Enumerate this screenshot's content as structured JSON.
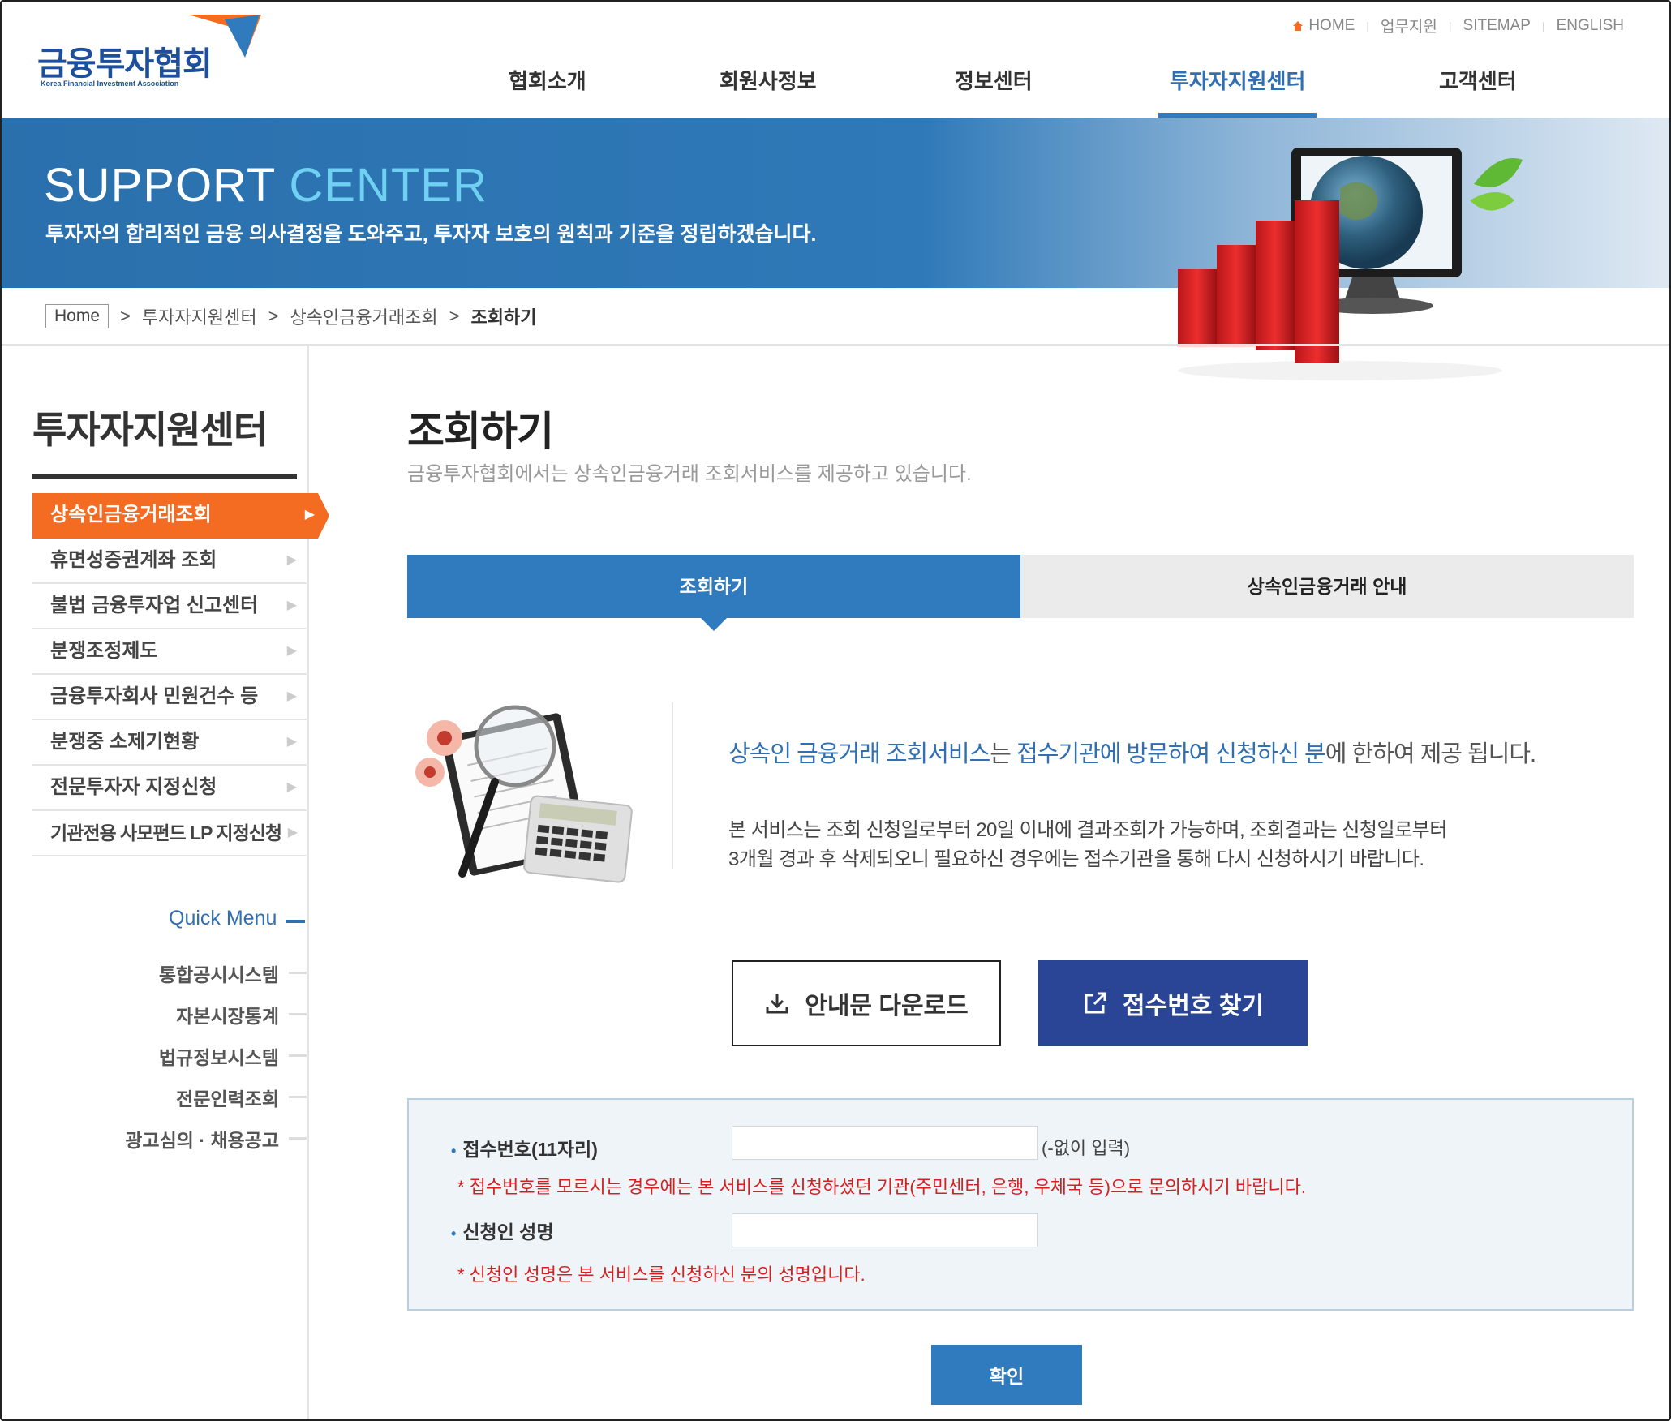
{
  "header": {
    "logo_text": "금융투자협회",
    "logo_sub": "Korea Financial Investment Association",
    "util_nav": [
      "HOME",
      "업무지원",
      "SITEMAP",
      "ENGLISH"
    ],
    "gnb": [
      {
        "label": "협회소개",
        "active": false
      },
      {
        "label": "회원사정보",
        "active": false
      },
      {
        "label": "정보센터",
        "active": false
      },
      {
        "label": "투자자지원센터",
        "active": true
      },
      {
        "label": "고객센터",
        "active": false
      }
    ]
  },
  "banner": {
    "title_main": "SUPPORT ",
    "title_accent": "CENTER",
    "subtitle": "투자자의 합리적인 금융 의사결정을 도와주고, 투자자 보호의 원칙과 기준을 정립하겠습니다."
  },
  "breadcrumb": {
    "home": "Home",
    "items": [
      "투자자지원센터",
      "상속인금융거래조회"
    ],
    "current": "조회하기",
    "separator": ">"
  },
  "sidebar": {
    "title": "투자자지원센터",
    "items": [
      {
        "label": "상속인금융거래조회",
        "active": true
      },
      {
        "label": "휴면성증권계좌 조회",
        "active": false
      },
      {
        "label": "불법 금융투자업 신고센터",
        "active": false
      },
      {
        "label": "분쟁조정제도",
        "active": false
      },
      {
        "label": "금융투자회사 민원건수 등",
        "active": false
      },
      {
        "label": "분쟁중 소제기현황",
        "active": false
      },
      {
        "label": "전문투자자 지정신청",
        "active": false
      },
      {
        "label": "기관전용 사모펀드 LP 지정신청",
        "active": false
      }
    ],
    "quick_menu_title": "Quick Menu",
    "quick_menu": [
      "통합공시시스템",
      "자본시장통계",
      "법규정보시스템",
      "전문인력조회",
      "광고심의 · 채용공고"
    ]
  },
  "main": {
    "title": "조회하기",
    "description": "금융투자협회에서는 상속인금융거래 조회서비스를 제공하고 있습니다.",
    "tabs": [
      {
        "label": "조회하기",
        "active": true
      },
      {
        "label": "상속인금융거래 안내",
        "active": false
      }
    ],
    "info": {
      "headline_1": "상속인 금융거래 조회서비스",
      "headline_2": "는 ",
      "headline_3": "접수기관에 방문하여 신청하신 분",
      "headline_4": "에 한하여 제공 됩니다.",
      "body_line_1": "본 서비스는 조회 신청일로부터 20일 이내에 결과조회가 가능하며, 조회결과는 신청일로부터",
      "body_line_2": "3개월 경과 후 삭제되오니 필요하신 경우에는 접수기관을 통해 다시 신청하시기 바랍니다."
    },
    "buttons": {
      "download": "안내문 다운로드",
      "find": "접수번호 찾기",
      "confirm": "확인"
    },
    "form": {
      "receipt_label": "접수번호(11자리)",
      "receipt_value": "",
      "receipt_hint": "(-없이 입력)",
      "receipt_note": "* 접수번호를 모르시는 경우에는 본 서비스를 신청하셨던 기관(주민센터, 은행, 우체국 등)으로 문의하시기 바랍니다.",
      "name_label": "신청인 성명",
      "name_value": "",
      "name_note": "* 신청인 성명은 본 서비스를 신청하신 분의 성명입니다."
    }
  },
  "colors": {
    "brand_blue": "#2f7bbd",
    "active_orange": "#f36c21",
    "find_button": "#2a4595",
    "note_red": "#d61f1f"
  }
}
